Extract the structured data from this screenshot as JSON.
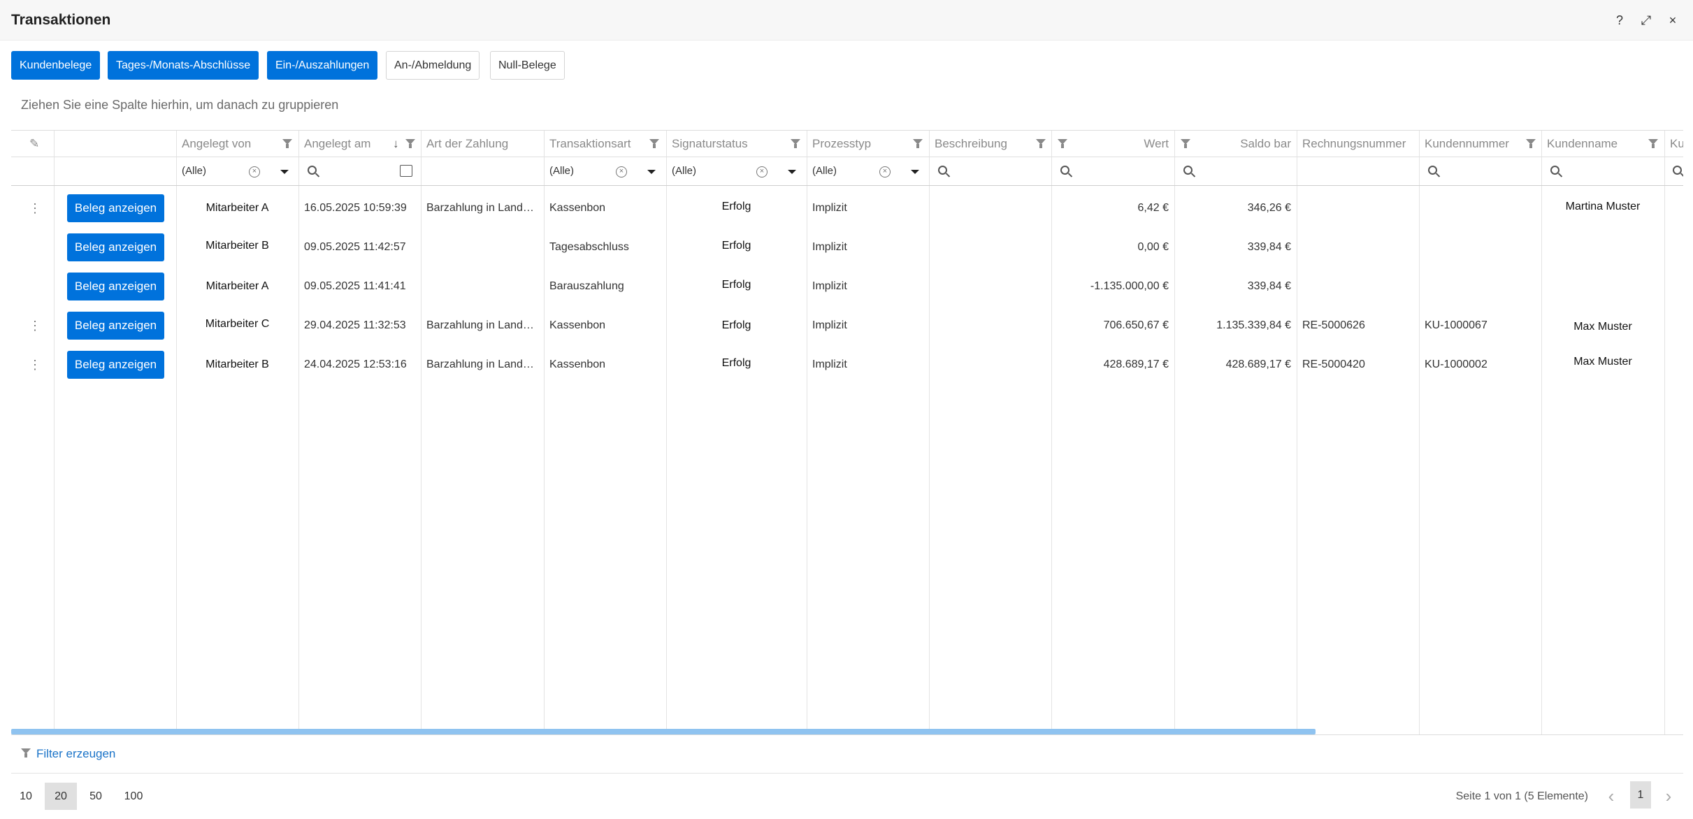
{
  "window": {
    "title": "Transaktionen",
    "help_glyph": "?",
    "maximize_glyph": "⤢",
    "close_glyph": "×"
  },
  "tabs": [
    {
      "label": "Kundenbelege",
      "active": true
    },
    {
      "label": "Tages-/Monats-Abschlüsse",
      "active": true
    },
    {
      "label": "Ein-/Auszahlungen",
      "active": true
    },
    {
      "label": "An-/Abmeldung",
      "active": false
    },
    {
      "label": "Null-Belege",
      "active": false
    }
  ],
  "group_panel": {
    "text": "Ziehen Sie eine Spalte hierhin, um danach zu gruppieren"
  },
  "columns": [
    {
      "key": "angelegt_von",
      "label": "Angelegt von",
      "filter_value": "(Alle)"
    },
    {
      "key": "angelegt_am",
      "label": "Angelegt am",
      "sort": "descending"
    },
    {
      "key": "art",
      "label": "Art der Zahlung"
    },
    {
      "key": "transaktionsart",
      "label": "Transaktionsart",
      "filter_value": "(Alle)"
    },
    {
      "key": "signaturstatus",
      "label": "Signaturstatus",
      "filter_value": "(Alle)"
    },
    {
      "key": "prozesstyp",
      "label": "Prozesstyp",
      "filter_value": "(Alle)"
    },
    {
      "key": "beschreibung",
      "label": "Beschreibung"
    },
    {
      "key": "wert",
      "label": "Wert"
    },
    {
      "key": "saldo",
      "label": "Saldo bar"
    },
    {
      "key": "rechnungsnummer",
      "label": "Rechnungsnummer"
    },
    {
      "key": "kundennummer",
      "label": "Kundennummer"
    },
    {
      "key": "kundenname",
      "label": "Kundenname"
    },
    {
      "key": "extra",
      "label": "Ku"
    }
  ],
  "row_button_label": "Beleg anzeigen",
  "rows": [
    {
      "menu": true,
      "angelegt_von": "Mitarbeiter A",
      "angelegt_am": "16.05.2025 10:59:39",
      "art": "Barzahlung in Landeswährung",
      "transaktionsart": "Kassenbon",
      "signaturstatus": "Erfolg",
      "prozesstyp": "Implizit",
      "beschreibung": "",
      "wert": "6,42 €",
      "saldo": "346,26 €",
      "rechnungsnummer": "",
      "kundennummer": "",
      "kundenname": "Martina Muster"
    },
    {
      "menu": false,
      "angelegt_von": "Mitarbeiter B",
      "angelegt_am": "09.05.2025 11:42:57",
      "art": "",
      "transaktionsart": "Tagesabschluss",
      "signaturstatus": "Erfolg",
      "prozesstyp": "Implizit",
      "beschreibung": "",
      "wert": "0,00 €",
      "saldo": "339,84 €",
      "rechnungsnummer": "",
      "kundennummer": "",
      "kundenname": ""
    },
    {
      "menu": false,
      "angelegt_von": "Mitarbeiter A",
      "angelegt_am": "09.05.2025 11:41:41",
      "art": "",
      "transaktionsart": "Barauszahlung",
      "signaturstatus": "Erfolg",
      "prozesstyp": "Implizit",
      "beschreibung": "",
      "wert": "-1.135.000,00 €",
      "saldo": "339,84 €",
      "rechnungsnummer": "",
      "kundennummer": "",
      "kundenname": ""
    },
    {
      "menu": true,
      "angelegt_von": "Mitarbeiter C",
      "angelegt_am": "29.04.2025 11:32:53",
      "art": "Barzahlung in Landeswährung",
      "transaktionsart": "Kassenbon",
      "signaturstatus": "Erfolg",
      "prozesstyp": "Implizit",
      "beschreibung": "",
      "wert": "706.650,67 €",
      "saldo": "1.135.339,84 €",
      "rechnungsnummer": "RE-5000626",
      "kundennummer": "KU-1000067",
      "kundenname": "Max Muster"
    },
    {
      "menu": true,
      "angelegt_von": "Mitarbeiter B",
      "angelegt_am": "24.04.2025 12:53:16",
      "art": "Barzahlung in Landeswährung",
      "transaktionsart": "Kassenbon",
      "signaturstatus": "Erfolg",
      "prozesstyp": "Implizit",
      "beschreibung": "",
      "wert": "428.689,17 €",
      "saldo": "428.689,17 €",
      "rechnungsnummer": "RE-5000420",
      "kundennummer": "KU-1000002",
      "kundenname": "Max Muster"
    }
  ],
  "footer": {
    "filter_link": "Filter erzeugen",
    "page_sizes": [
      "10",
      "20",
      "50",
      "100"
    ],
    "selected_page_size": "20",
    "page_info": "Seite 1 von 1 (5 Elemente)",
    "current_page": "1",
    "prev_glyph": "‹",
    "next_glyph": "›"
  },
  "colors": {
    "accent": "#0072dc",
    "link": "#1a73c8",
    "scrollbar": "#8fc3f0"
  }
}
